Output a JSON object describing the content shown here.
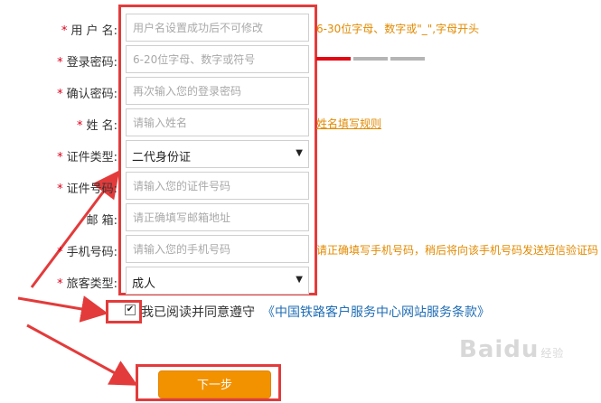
{
  "form": {
    "rows": [
      {
        "label": "用 户 名:",
        "placeholder": "用户名设置成功后不可修改",
        "hint": "6-30位字母、数字或\"_\",字母开头"
      },
      {
        "label": "登录密码:",
        "placeholder": "6-20位字母、数字或符号"
      },
      {
        "label": "确认密码:",
        "placeholder": "再次输入您的登录密码"
      },
      {
        "label": "姓 名:",
        "placeholder": "请输入姓名",
        "hint": "姓名填写规则"
      },
      {
        "label": "证件类型:",
        "selected": "二代身份证"
      },
      {
        "label": "证件号码:",
        "placeholder": "请输入您的证件号码"
      },
      {
        "label": "邮 箱:",
        "placeholder": "请正确填写邮箱地址"
      },
      {
        "label": "手机号码:",
        "placeholder": "请输入您的手机号码",
        "hint": "请正确填写手机号码，稍后将向该手机号码发送短信验证码"
      },
      {
        "label": "旅客类型:",
        "selected": "成人"
      }
    ],
    "required_mark": "*",
    "password_strength_colors": [
      "#e30613",
      "#b5b5b5",
      "#b5b5b5"
    ]
  },
  "agreement": {
    "checked": true,
    "check_glyph": "✔",
    "text": "我已阅读并同意遵守",
    "link": "《中国铁路客户服务中心网站服务条款》"
  },
  "next_button": {
    "label": "下一步"
  },
  "watermark": {
    "brand": "Baidu",
    "suffix": "经验"
  },
  "colors": {
    "annotation": "#e33b3b",
    "accent": "#f39200",
    "hint": "#e28a00",
    "link": "#1f6db5"
  },
  "icons": {
    "select_arrow": "▼"
  }
}
